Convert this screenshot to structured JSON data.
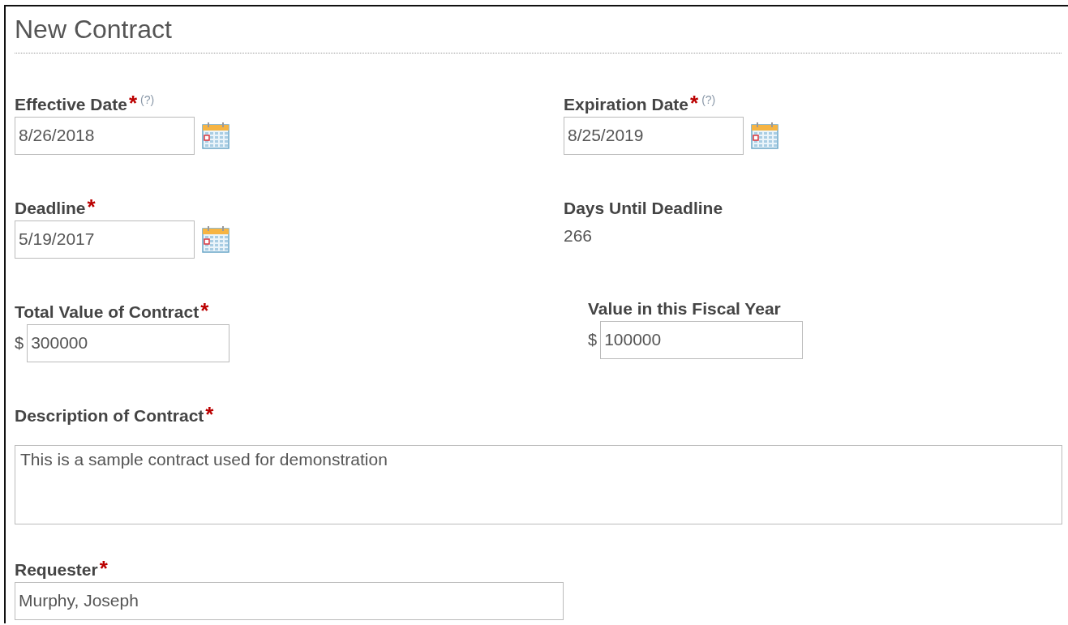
{
  "title": "New Contract",
  "rows": [
    {
      "fields": [
        {
          "kind": "date",
          "label": "Effective Date",
          "required_mark": "*",
          "help": "(?)",
          "value": "8/26/2018"
        },
        {
          "kind": "date",
          "label": "Expiration Date",
          "required_mark": "*",
          "help": "(?)",
          "value": "8/25/2019"
        }
      ]
    },
    {
      "fields": [
        {
          "kind": "date",
          "label": "Deadline",
          "required_mark": "*",
          "value": "5/19/2017"
        },
        {
          "kind": "readonly",
          "label": "Days Until Deadline",
          "value": "266"
        }
      ]
    },
    {
      "fields": [
        {
          "kind": "currency",
          "label": "Total Value of Contract",
          "required_mark": "*",
          "currency": "$",
          "value": "300000"
        },
        {
          "kind": "currency",
          "label": "Value in this Fiscal Year",
          "currency": "$",
          "value": "100000"
        }
      ]
    },
    {
      "fields": [
        {
          "kind": "textarea",
          "label": "Description of Contract",
          "required_mark": "*",
          "value": "This is a sample contract used for demonstration"
        }
      ]
    },
    {
      "fields": [
        {
          "kind": "text",
          "label": "Requester",
          "required_mark": "*",
          "value": "Murphy, Joseph"
        }
      ]
    }
  ]
}
